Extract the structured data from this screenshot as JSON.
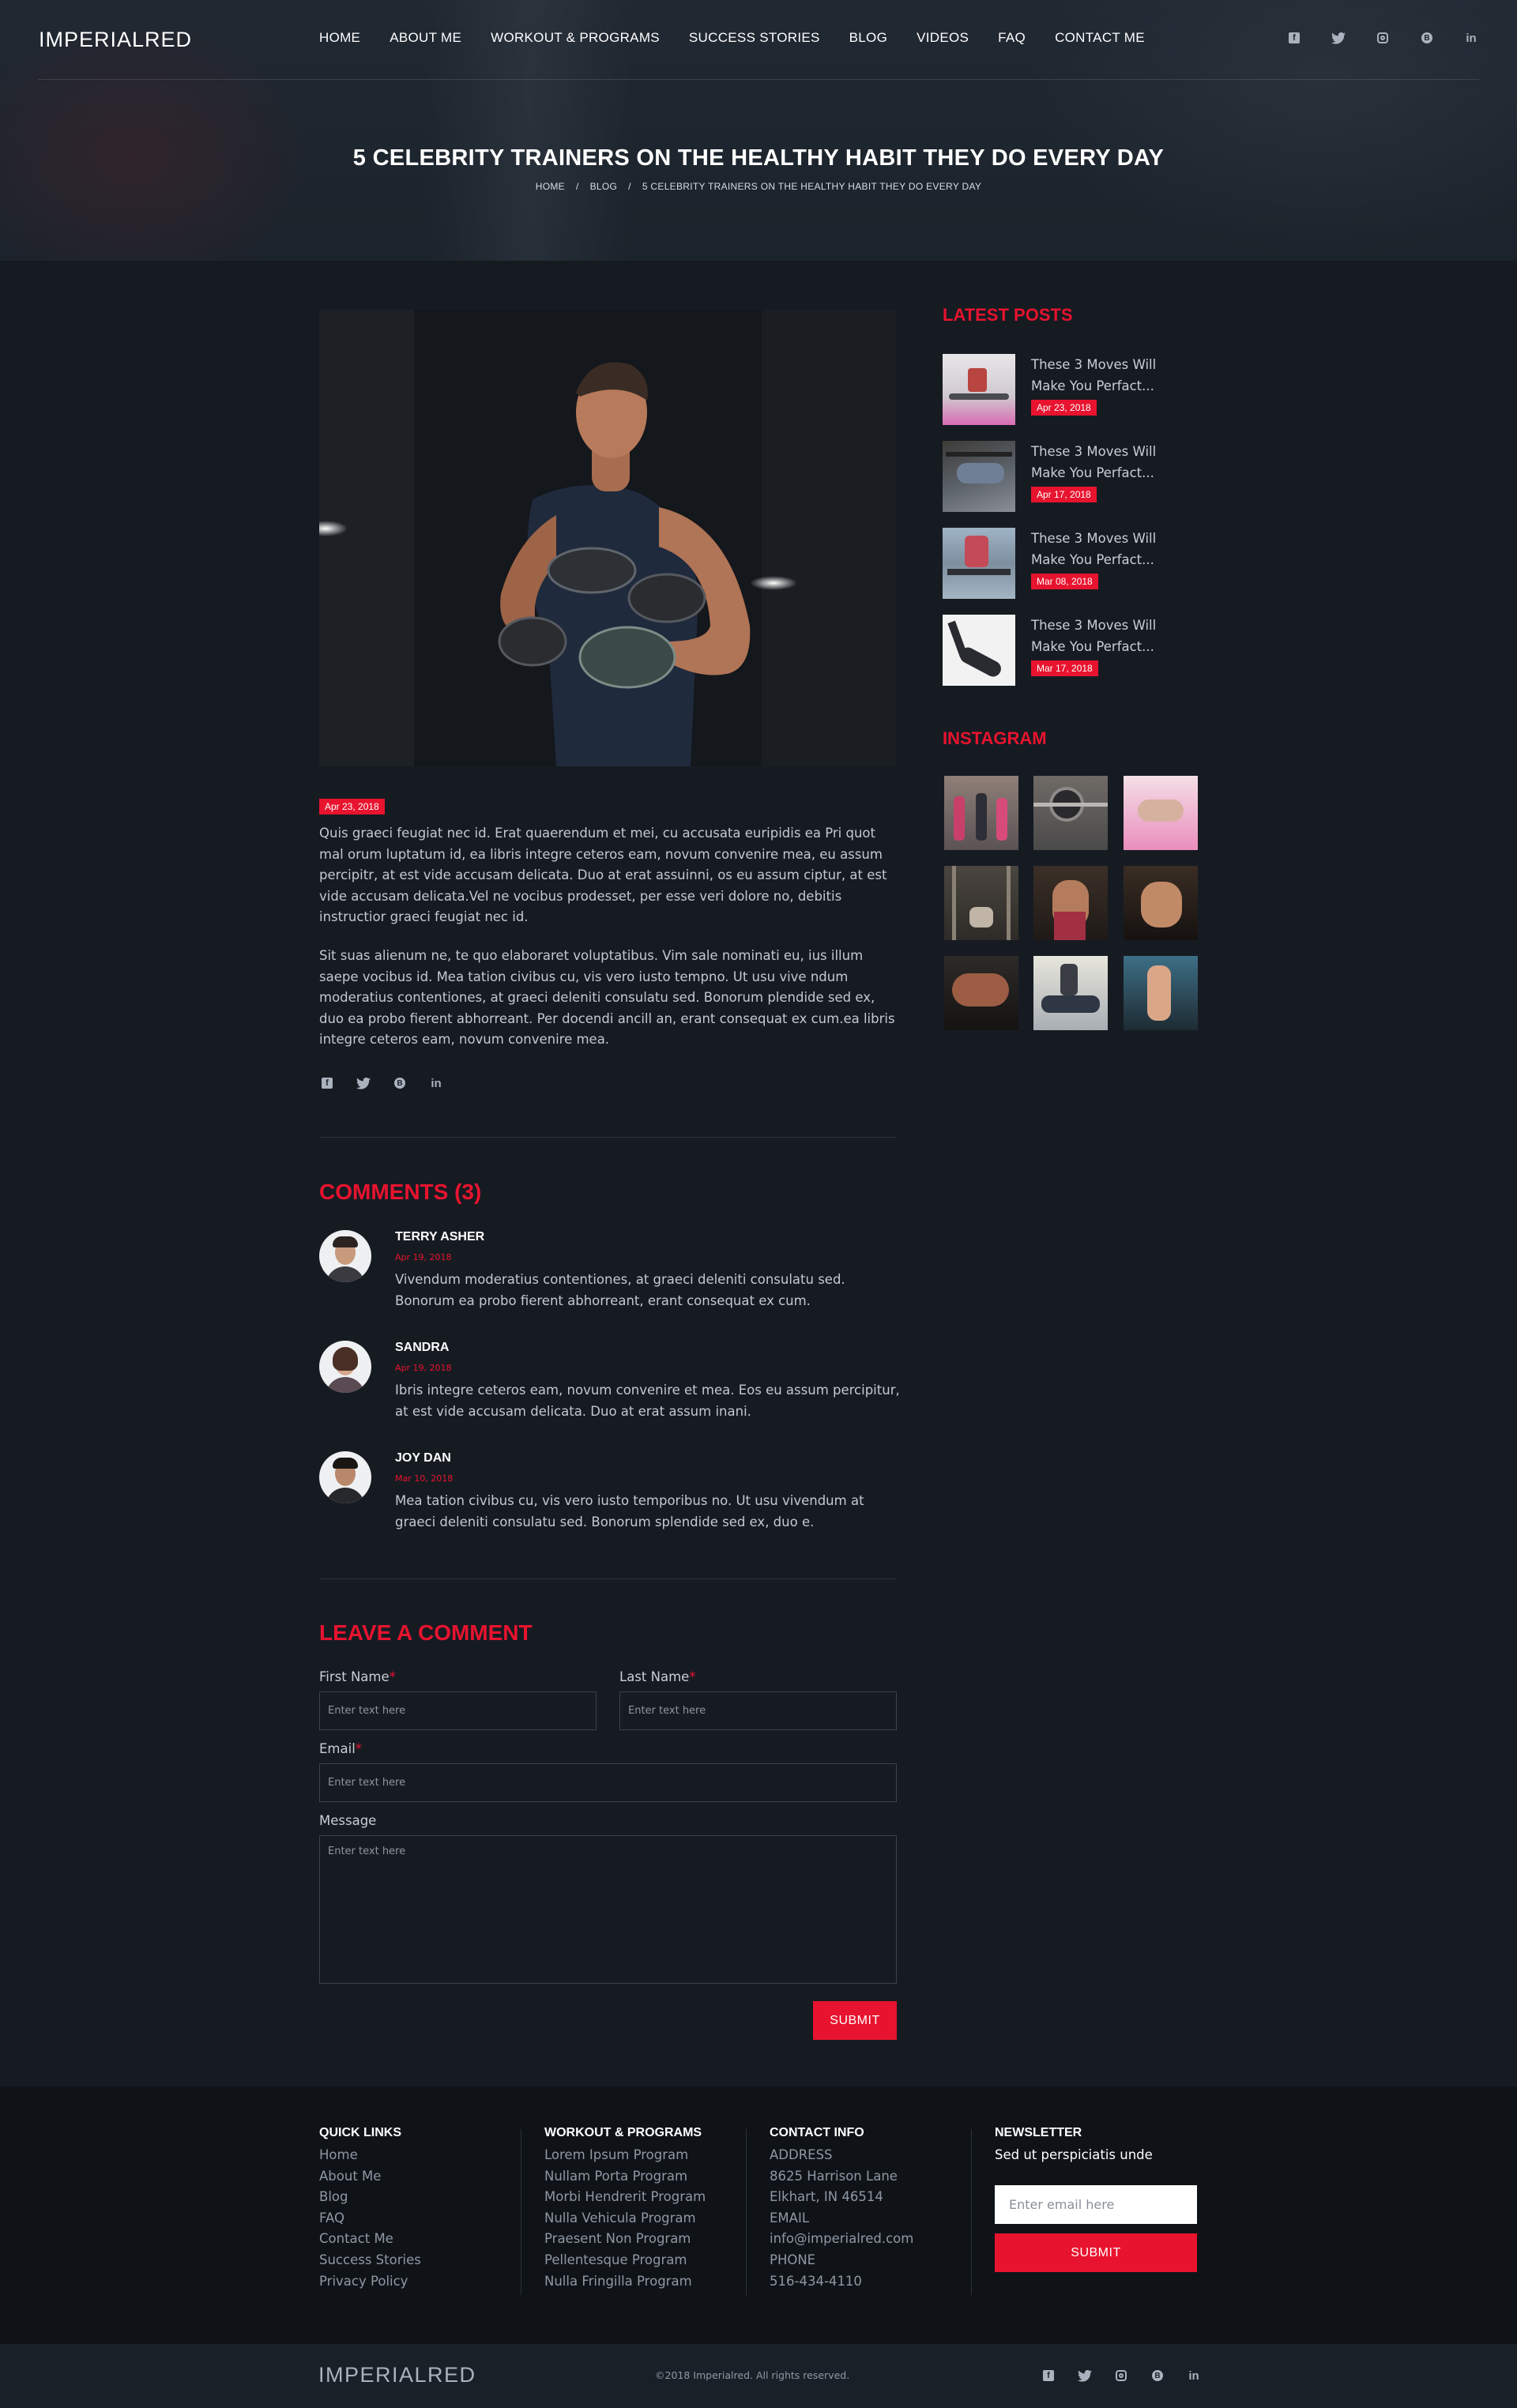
{
  "site": {
    "logo": "IMPERIALRED"
  },
  "nav": [
    "HOME",
    "ABOUT ME",
    "WORKOUT & PROGRAMS",
    "SUCCESS STORIES",
    "BLOG",
    "VIDEOS",
    "FAQ",
    "CONTACT ME"
  ],
  "social_icons": [
    "facebook-icon",
    "twitter-icon",
    "instagram-icon",
    "blogger-icon",
    "linkedin-icon"
  ],
  "hero": {
    "title": "5 CELEBRITY TRAINERS ON THE HEALTHY HABIT THEY DO EVERY DAY",
    "breadcrumb": [
      "HOME",
      "/",
      "BLOG",
      "/",
      "5 CELEBRITY TRAINERS ON THE HEALTHY HABIT THEY DO EVERY DAY"
    ]
  },
  "post": {
    "date": "Apr 23, 2018",
    "paragraphs": [
      "Quis graeci feugiat nec id. Erat quaerendum et mei, cu accusata euripidis ea Pri quot mal orum luptatum id, ea libris integre ceteros eam, novum convenire mea, eu assum percipitr, at est vide accusam delicata. Duo at erat assuinni, os eu assum ciptur, at est vide accusam delicata.Vel ne vocibus prodesset, per esse veri dolore no, debitis instructior graeci feugiat nec id.",
      "Sit suas alienum ne, te quo elaboraret voluptatibus. Vim sale nominati eu, ius illum saepe vocibus id. Mea tation civibus cu, vis vero iusto tempno. Ut usu vive ndum moderatius contentiones, at graeci deleniti consulatu sed. Bonorum plendide sed ex, duo ea probo fierent abhorreant. Per docendi ancill an, erant consequat ex cum.ea libris integre ceteros eam, novum convenire mea."
    ]
  },
  "comments": {
    "heading": "COMMENTS (3)",
    "items": [
      {
        "name": "TERRY ASHER",
        "date": "Apr 19, 2018",
        "text": "Vivendum moderatius contentiones, at graeci deleniti consulatu sed. Bonorum ea probo fierent abhorreant, erant consequat ex cum."
      },
      {
        "name": "SANDRA",
        "date": "Apr 19, 2018",
        "text": "Ibris integre ceteros eam, novum convenire et mea. Eos eu assum percipitur, at est vide accusam delicata. Duo at erat assum inani."
      },
      {
        "name": "JOY DAN",
        "date": "Mar 10, 2018",
        "text": "Mea tation civibus cu, vis vero iusto temporibus no. Ut usu vivendum at graeci deleniti consulatu sed. Bonorum splendide sed ex, duo e."
      }
    ]
  },
  "form": {
    "heading": "LEAVE A COMMENT",
    "first_name_label": "First Name",
    "last_name_label": "Last Name",
    "email_label": "Email",
    "message_label": "Message",
    "required_mark": "*",
    "placeholder": "Enter text here",
    "submit": "SUBMIT"
  },
  "sidebar": {
    "latest_heading": "LATEST POSTS",
    "latest": [
      {
        "title": "These 3 Moves Will Make You Perfact...",
        "date": "Apr 23, 2018"
      },
      {
        "title": "These 3 Moves Will Make You Perfact...",
        "date": "Apr 17, 2018"
      },
      {
        "title": "These 3 Moves Will Make You Perfact...",
        "date": "Mar 08, 2018"
      },
      {
        "title": "These 3 Moves Will Make You Perfact...",
        "date": "Mar 17, 2018"
      }
    ],
    "instagram_heading": "INSTAGRAM"
  },
  "footer": {
    "quick_links_heading": "QUICK LINKS",
    "quick_links": [
      "Home",
      "About Me",
      "Blog",
      "FAQ",
      "Contact Me",
      "Success Stories",
      "Privacy Policy"
    ],
    "programs_heading": "WORKOUT & PROGRAMS",
    "programs": [
      "Lorem Ipsum Program",
      "Nullam Porta Program",
      "Morbi Hendrerit Program",
      "Nulla Vehicula Program",
      "Praesent Non Program",
      "Pellentesque Program",
      "Nulla Fringilla Program"
    ],
    "contact_heading": "CONTACT INFO",
    "address_label": "ADDRESS",
    "address_line1": "8625 Harrison Lane",
    "address_line2": "Elkhart, IN 46514",
    "email_label": "EMAIL",
    "email": "info@imperialred.com",
    "phone_label": "PHONE",
    "phone": "516-434-4110",
    "newsletter_heading": "NEWSLETTER",
    "newsletter_text": "Sed ut perspiciatis unde",
    "newsletter_placeholder": "Enter email here",
    "newsletter_button": "SUBMIT",
    "logo": "IMPERIALRED",
    "copyright": "©2018 Imperialred. All rights reserved."
  },
  "colors": {
    "accent": "#e8132e",
    "background": "#161b22",
    "footer": "#0f1318"
  }
}
